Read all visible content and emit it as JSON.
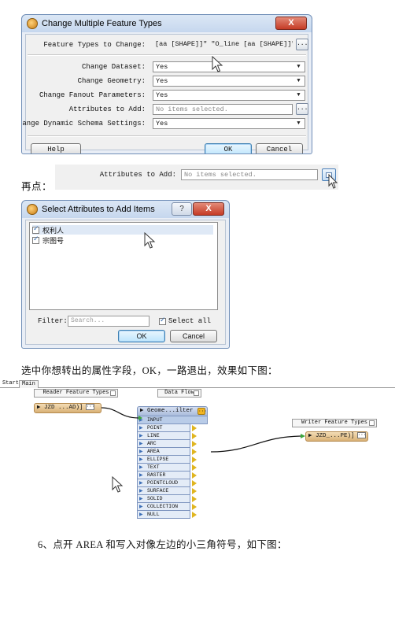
{
  "dialog1": {
    "title": "Change Multiple Feature Types",
    "close_label": "X",
    "rows": [
      {
        "label": "Feature Types to Change:",
        "value": "[aa [SHAPE]]\" \"O_line [aa [SHAPE]]\""
      },
      {
        "label": "Change Dataset:",
        "value": "Yes"
      },
      {
        "label": "Change Geometry:",
        "value": "Yes"
      },
      {
        "label": "Change Fanout Parameters:",
        "value": "Yes"
      },
      {
        "label": "Attributes to Add:",
        "value": "No items selected."
      },
      {
        "label": "Change Dynamic Schema Settings:",
        "value": "Yes"
      }
    ],
    "dots_label": "...",
    "help_label": "Help",
    "ok_label": "OK",
    "cancel_label": "Cancel"
  },
  "caption1": "再点：",
  "strip": {
    "label": "Attributes to Add:",
    "value": "No items selected."
  },
  "dialog2": {
    "title": "Select Attributes to Add Items",
    "help_label": "?",
    "close_label": "X",
    "items": [
      "权利人",
      "宗图号"
    ],
    "filter_label": "Filter:",
    "filter_placeholder": "Search...",
    "select_all_label": "Select all",
    "ok_label": "OK",
    "cancel_label": "Cancel"
  },
  "caption2": "选中你想转出的属性字段，OK，一路退出，效果如下图：",
  "workspace": {
    "tabs": [
      "Start",
      "Main"
    ],
    "bookmarks": [
      "Reader Feature Types",
      "Data Flow",
      "Writer Feature Types"
    ],
    "reader_feature": "JZD ...AD)]",
    "writer_feature": "JZD_...PE)]",
    "transformer_title": "Geome...ilter",
    "ports": [
      "INPUT",
      "POINT",
      "LINE",
      "ARC",
      "AREA",
      "ELLIPSE",
      "TEXT",
      "RASTER",
      "POINTCLOUD",
      "SURFACE",
      "SOLID",
      "COLLECTION",
      "NULL"
    ]
  },
  "caption3": "6、点开 AREA 和写入对像左边的小三角符号，如下图："
}
